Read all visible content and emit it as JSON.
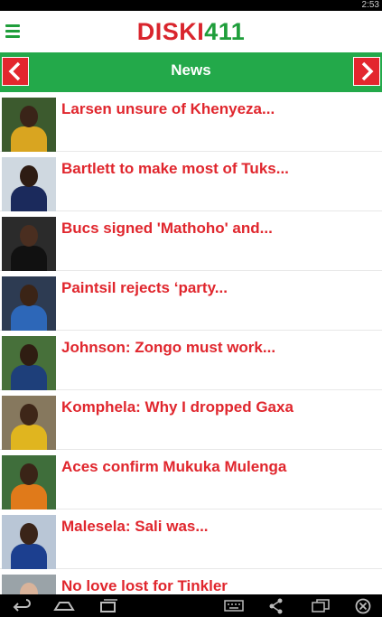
{
  "status": {
    "time": "2:53"
  },
  "app": {
    "logo_part1": "DISKI",
    "logo_part2": "411",
    "brand_red": "#d9252d",
    "brand_green": "#1f9e3b"
  },
  "nav": {
    "title": "News",
    "bar_color": "#23a94a",
    "prev_icon": "chevron-left-icon",
    "next_icon": "chevron-right-icon"
  },
  "news": [
    {
      "headline": "Larsen unsure of Khenyeza...",
      "thumb": {
        "bg": "#3c5a2e",
        "jersey": "#d9a520",
        "skin": "#3a2418"
      }
    },
    {
      "headline": "Bartlett to make most of Tuks...",
      "thumb": {
        "bg": "#cfd8e0",
        "jersey": "#1b2a5c",
        "skin": "#2e1c13"
      }
    },
    {
      "headline": "Bucs signed 'Mathoho' and...",
      "thumb": {
        "bg": "#2b2b2b",
        "jersey": "#111111",
        "skin": "#4a2e20"
      }
    },
    {
      "headline": "Paintsil rejects ‘party...",
      "thumb": {
        "bg": "#2d3b52",
        "jersey": "#2d67b8",
        "skin": "#3b2416"
      }
    },
    {
      "headline": "Johnson: Zongo must work...",
      "thumb": {
        "bg": "#47703a",
        "jersey": "#1e3f7a",
        "skin": "#2f1d12"
      }
    },
    {
      "headline": "Komphela: Why I dropped Gaxa",
      "thumb": {
        "bg": "#86785e",
        "jersey": "#e0b51f",
        "skin": "#3e2618"
      }
    },
    {
      "headline": "Aces confirm Mukuka Mulenga",
      "thumb": {
        "bg": "#3f6e3b",
        "jersey": "#e07a1a",
        "skin": "#3a2417"
      }
    },
    {
      "headline": "Malesela: Sali was...",
      "thumb": {
        "bg": "#b9c6d6",
        "jersey": "#1c3f8f",
        "skin": "#3a2418"
      }
    },
    {
      "headline": "No love lost for Tinkler",
      "thumb": {
        "bg": "#9aa3a8",
        "jersey": "#c8c8c8",
        "skin": "#d9b39a"
      }
    }
  ],
  "system_nav": {
    "back": "back-icon",
    "home": "home-icon",
    "recents": "recents-icon",
    "keyboard": "keyboard-icon",
    "share": "share-icon",
    "window": "window-icon",
    "close": "close-icon"
  }
}
